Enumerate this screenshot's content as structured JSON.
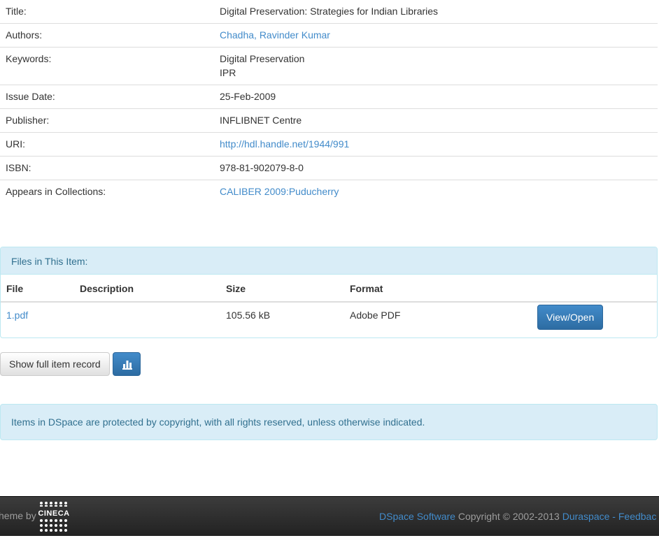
{
  "metadata": {
    "title_label": "Title:",
    "title_value": "Digital Preservation: Strategies for Indian Libraries",
    "authors_label": "Authors:",
    "authors_value": "Chadha, Ravinder Kumar",
    "keywords_label": "Keywords:",
    "keywords_values": [
      "Digital Preservation",
      "IPR"
    ],
    "issue_date_label": "Issue Date:",
    "issue_date_value": "25-Feb-2009",
    "publisher_label": "Publisher:",
    "publisher_value": "INFLIBNET Centre",
    "uri_label": "URI:",
    "uri_value": "http://hdl.handle.net/1944/991",
    "isbn_label": "ISBN:",
    "isbn_value": "978-81-902079-8-0",
    "collections_label": "Appears in Collections:",
    "collections_value": "CALIBER 2009:Puducherry"
  },
  "files": {
    "heading": "Files in This Item:",
    "columns": [
      "File",
      "Description",
      "Size",
      "Format"
    ],
    "rows": [
      {
        "file": "1.pdf",
        "description": "",
        "size": "105.56 kB",
        "format": "Adobe PDF",
        "action": "View/Open"
      }
    ]
  },
  "actions": {
    "full_record_label": "Show full item record",
    "stats_icon": "bar-chart-icon"
  },
  "notice": {
    "text": "Items in DSpace are protected by copyright, with all rights reserved, unless otherwise indicated."
  },
  "footer": {
    "theme_by": "heme by",
    "logo_text": "CINECA",
    "dspace_link": "DSpace Software",
    "copyright": " Copyright © 2002-2013 ",
    "duraspace_link": "Duraspace",
    "separator": " - ",
    "feedback_link": "Feedbac"
  },
  "colors": {
    "link": "#428bca",
    "panel_heading_bg": "#d9edf7",
    "panel_border": "#bce8f1",
    "primary_button": "#337ab7",
    "footer_bg": "#222222"
  }
}
